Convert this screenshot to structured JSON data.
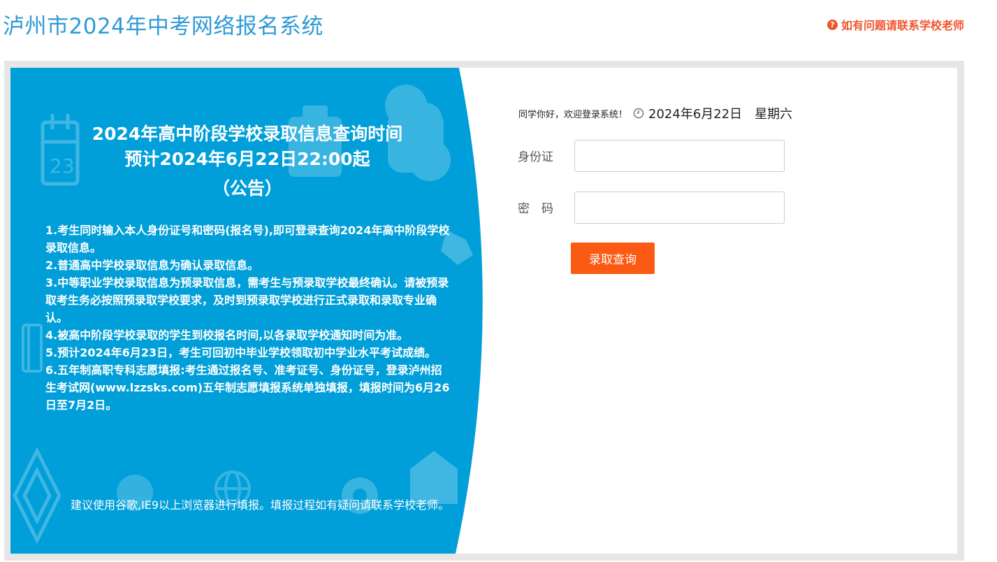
{
  "header": {
    "title": "泸州市2024年中考网络报名系统",
    "help_text": "如有问题请联系学校老师",
    "help_icon": "question-circle-icon"
  },
  "banner": {
    "background_color": "#009fd9",
    "title_lines": [
      "2024年高中阶段学校录取信息查询时间",
      "预计2024年6月22日22:00起",
      "（公告）"
    ],
    "notices": [
      "1.考生同时输入本人身份证号和密码(报名号),即可登录查询2024年高中阶段学校录取信息。",
      "2.普通高中学校录取信息为确认录取信息。",
      "3.中等职业学校录取信息为预录取信息，需考生与预录取学校最终确认。请被预录取考生务必按照预录取学校要求，及时到预录取学校进行正式录取和录取专业确认。",
      "4.被高中阶段学校录取的学生到校报名时间,以各录取学校通知时间为准。",
      "5.预计2024年6月23日，考生可回初中毕业学校领取初中学业水平考试成绩。",
      "6.五年制高职专科志愿填报:考生通过报名号、准考证号、身份证号，登录泸州招生考试网(www.lzzsks.com)五年制志愿填报系统单独填报，填报时间为6月26日至7月2日。"
    ],
    "calendar_day": "23",
    "browser_tip": "建议使用谷歌,IE9以上浏览器进行填报。填报过程如有疑问请联系学校老师。"
  },
  "login": {
    "welcome": "同学你好，欢迎登录系统！",
    "clock_icon": "clock-icon",
    "date": "2024年6月22日",
    "weekday": "星期六",
    "id_label": "身份证",
    "id_value": "",
    "password_label": "密　码",
    "password_value": "",
    "submit_label": "录取查询"
  },
  "colors": {
    "title": "#2f9ad6",
    "help": "#f0542d",
    "button": "#fa5a14",
    "banner": "#009fd9",
    "frame": "#e6e6e6"
  }
}
